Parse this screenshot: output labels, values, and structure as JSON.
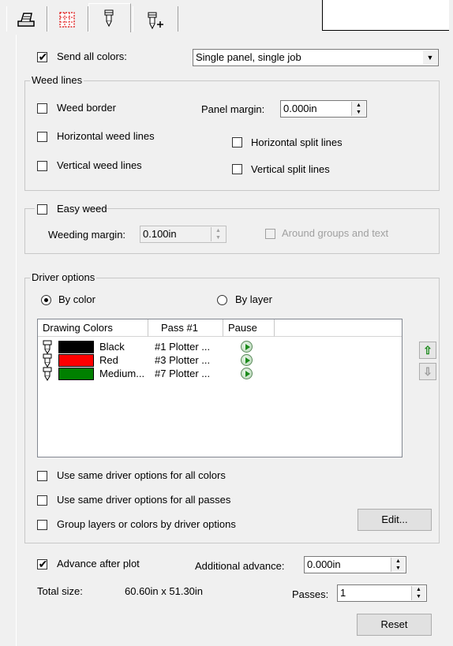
{
  "tabs": [
    {
      "name": "plot-preview-tab",
      "icon": "plotter-icon"
    },
    {
      "name": "panel-tab",
      "icon": "panel-grid-icon"
    },
    {
      "name": "pen-tab",
      "icon": "pen-icon",
      "active": true
    },
    {
      "name": "pen-plus-tab",
      "icon": "pen-plus-icon"
    }
  ],
  "send_all_colors": {
    "label": "Send all colors:",
    "checked": true,
    "value": "Single panel, single job"
  },
  "weed_lines": {
    "title": "Weed lines",
    "weed_border": "Weed border",
    "panel_margin_label": "Panel margin:",
    "panel_margin_value": "0.000in",
    "horizontal_weed_lines": "Horizontal weed lines",
    "horizontal_split_lines": "Horizontal split lines",
    "vertical_weed_lines": "Vertical weed lines",
    "vertical_split_lines": "Vertical split lines"
  },
  "easy_weed": {
    "label": "Easy weed",
    "weeding_margin_label": "Weeding margin:",
    "weeding_margin_value": "0.100in",
    "around_groups": "Around groups and text"
  },
  "driver_options": {
    "title": "Driver options",
    "by_color": "By color",
    "by_layer": "By layer",
    "selected": "By color",
    "columns": [
      "Drawing Colors",
      "Pass #1",
      "Pause"
    ],
    "rows": [
      {
        "color_name": "Black",
        "swatch": "#000000",
        "pass": "#1 Plotter ..."
      },
      {
        "color_name": "Red",
        "swatch": "#ff0000",
        "pass": "#3 Plotter ..."
      },
      {
        "color_name": "Medium...",
        "swatch": "#008000",
        "pass": "#7 Plotter ..."
      }
    ],
    "same_for_all_colors": "Use same driver options for all colors",
    "same_for_all_passes": "Use same driver options for all passes",
    "group_layers": "Group layers or colors by driver options",
    "edit_button": "Edit..."
  },
  "advance": {
    "label": "Advance after plot",
    "checked": true,
    "additional_label": "Additional advance:",
    "additional_value": "0.000in"
  },
  "total_size": {
    "label": "Total size:",
    "value": "60.60in x 51.30in"
  },
  "passes": {
    "label": "Passes:",
    "value": "1"
  },
  "reset_button": "Reset",
  "colors": {
    "accent_green": "#1a8a1a",
    "window_bg": "#f0f0f0"
  }
}
